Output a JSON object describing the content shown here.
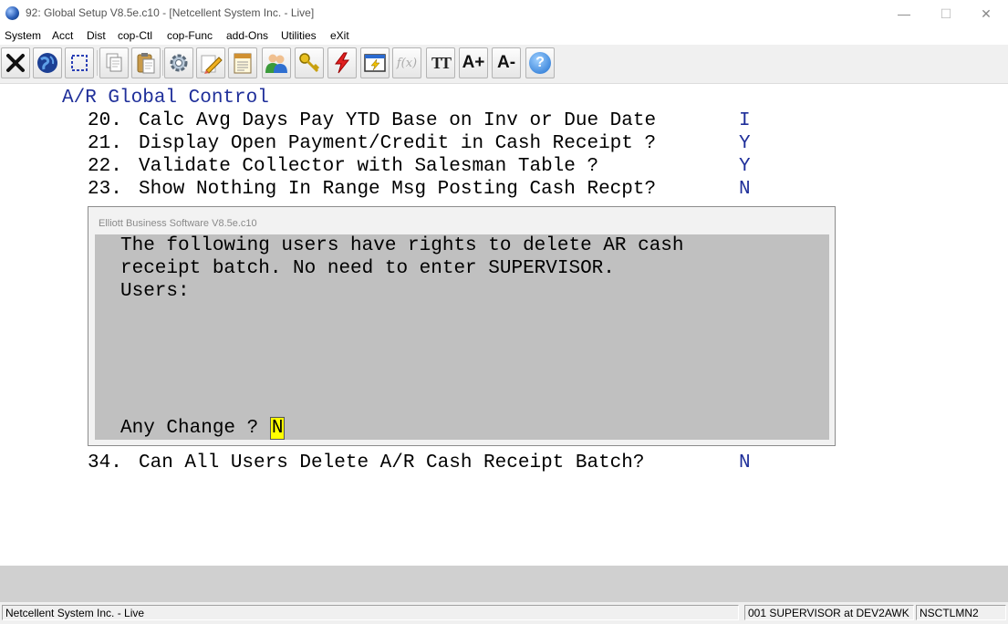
{
  "window": {
    "title": "92: Global Setup V8.5e.c10 - [Netcellent System Inc. - Live]",
    "minimize_glyph": "—",
    "maximize_glyph": "☐",
    "close_glyph": "✕"
  },
  "menu": [
    "System",
    "Acct",
    "Dist",
    "cop-Ctl",
    "cop-Func",
    "add-Ons",
    "Utilities",
    "eXit"
  ],
  "toolbar": {
    "icons": [
      "exit-icon",
      "globe-icon",
      "select-icon",
      "copy-icon",
      "paste-icon",
      "settings-gear-icon",
      "edit-pencil-icon",
      "notepad-icon",
      "users-icon",
      "keys-icon",
      "lightning-icon",
      "screen-lightning-icon",
      "function-icon",
      "font-tt-icon",
      "font-increase-icon",
      "font-decrease-icon",
      "help-icon"
    ],
    "font_tt_label": "TT",
    "font_increase_label": "A+",
    "font_decrease_label": "A-",
    "function_label": "f(x)",
    "help_label": "?"
  },
  "screen": {
    "section_title": "A/R Global Control",
    "items": [
      {
        "num": "20.",
        "label": "Calc Avg Days Pay YTD Base on Inv or Due Date",
        "value": "I"
      },
      {
        "num": "21.",
        "label": "Display Open Payment/Credit in Cash Receipt ?",
        "value": "Y"
      },
      {
        "num": "22.",
        "label": "Validate Collector with Salesman Table ?",
        "value": "Y"
      },
      {
        "num": "23.",
        "label": "Show Nothing In Range Msg Posting Cash Recpt?",
        "value": "N"
      },
      {
        "num": "34.",
        "label": "Can All Users Delete A/R Cash Receipt Batch?",
        "value": "N"
      }
    ]
  },
  "dialog": {
    "title": "Elliott Business Software V8.5e.c10",
    "line1": "The following users have rights to delete AR cash",
    "line2": "receipt batch. No need to enter SUPERVISOR.",
    "users_label": "Users:",
    "prompt": "Any Change ?",
    "answer": "N"
  },
  "status": {
    "company": "Netcellent System Inc. - Live",
    "user": "001 SUPERVISOR at DEV2AWK",
    "machine": "NSCTLMN2"
  },
  "colors": {
    "term_value_blue": "#1f2f9a",
    "dialog_body": "#c0c0c0",
    "cursor_yellow": "#ffff00"
  }
}
